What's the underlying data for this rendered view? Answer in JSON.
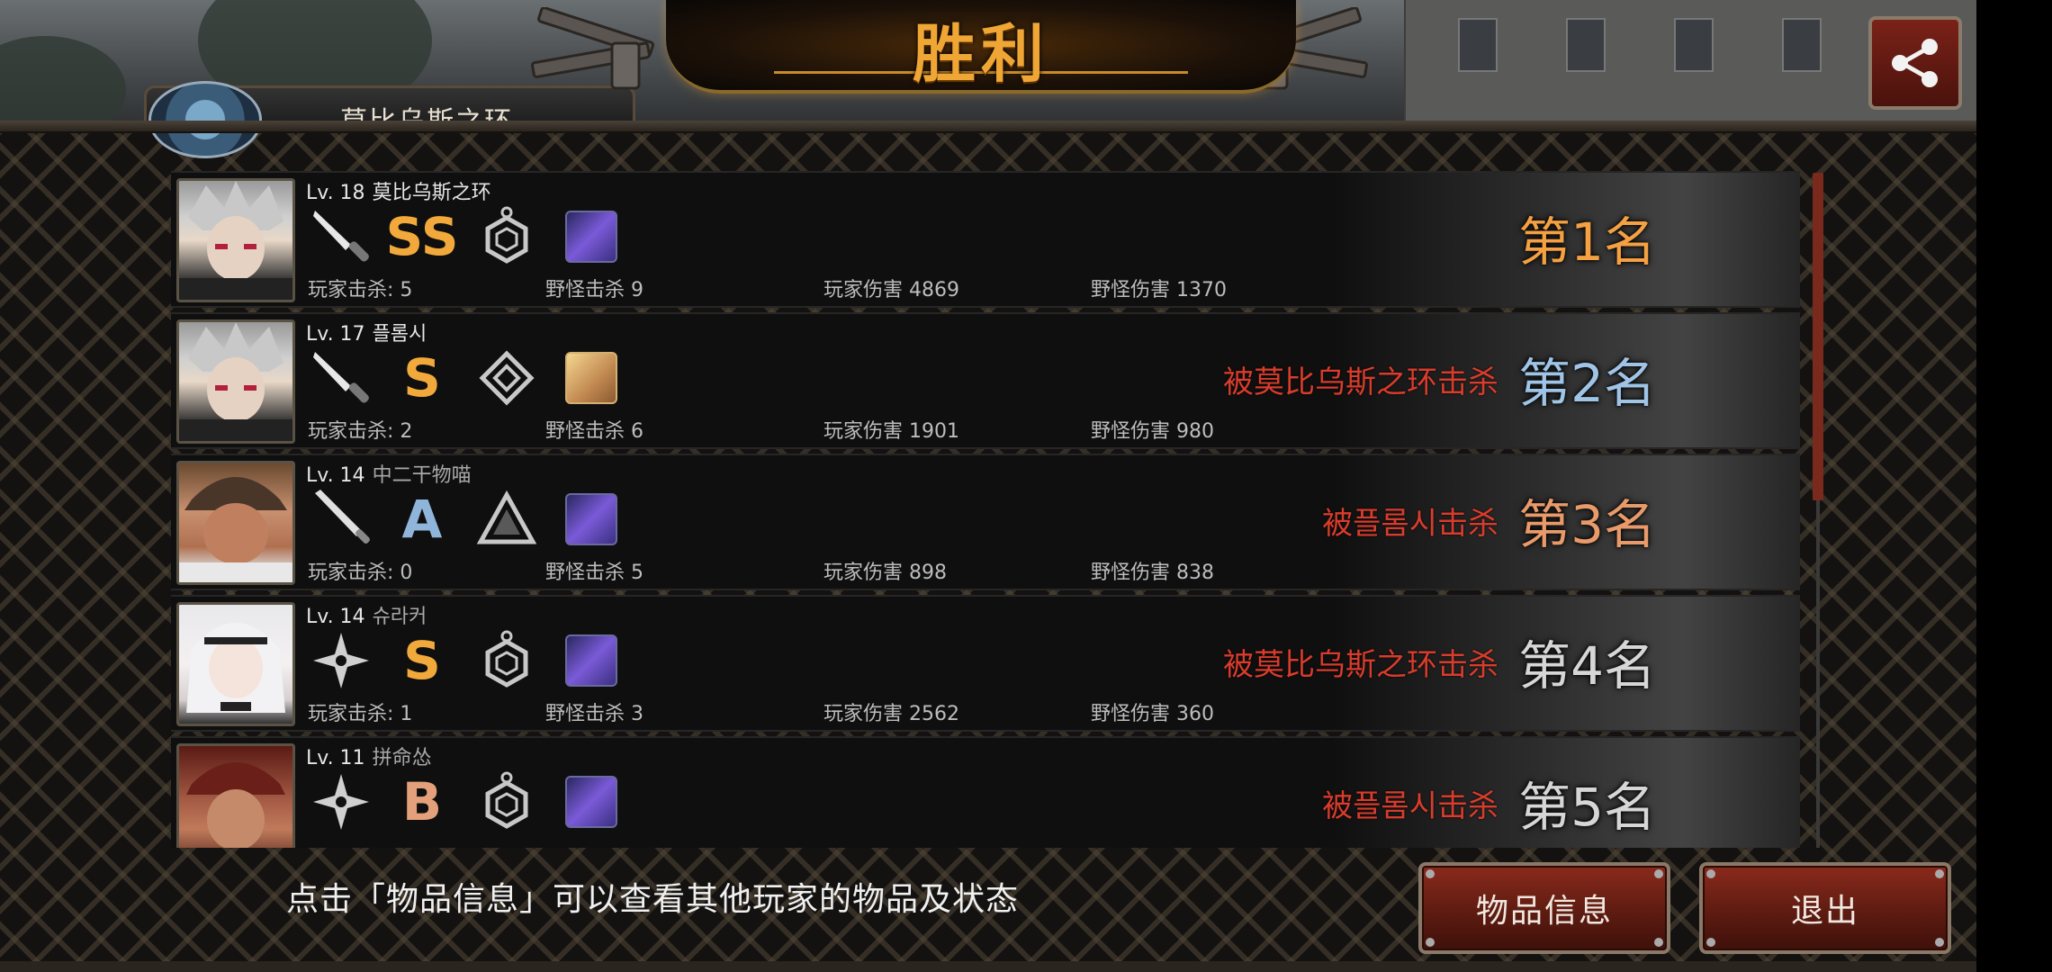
{
  "header": {
    "title": "胜利",
    "player_tab_name": "莫比乌斯之环"
  },
  "colors": {
    "title_gold": "#f0a635",
    "killed_by_red": "#d83c2c",
    "rank1": "#f4a043",
    "rank2": "#9fc4e6",
    "rank3": "#e89a6a",
    "rank_default": "#d6d6d6",
    "button_red": "#7a2218"
  },
  "icons": {
    "share": "share-icon",
    "weapon_knife": "knife-icon",
    "weapon_bat": "bat-icon",
    "weapon_shuriken": "shuriken-icon",
    "pet_purple": "purple-pet-icon",
    "pet_gold": "gold-pet-icon"
  },
  "players": [
    {
      "lv_label": "Lv. 18",
      "name": "莫比乌斯之环",
      "weapon": "knife",
      "grade": "SS",
      "killed_by": "",
      "rank": "第1名",
      "stats": {
        "player_kills": "玩家击杀: 5",
        "monster_kills": "野怪击杀 9",
        "player_damage": "玩家伤害 4869",
        "monster_damage": "野怪伤害 1370"
      }
    },
    {
      "lv_label": "Lv. 17",
      "name": "플롬시",
      "weapon": "knife",
      "grade": "S",
      "killed_by": "被莫比乌斯之环击杀",
      "rank": "第2名",
      "stats": {
        "player_kills": "玩家击杀: 2",
        "monster_kills": "野怪击杀 6",
        "player_damage": "玩家伤害 1901",
        "monster_damage": "野怪伤害 980"
      }
    },
    {
      "lv_label": "Lv. 14",
      "name": "中二干物喵",
      "weapon": "bat",
      "grade": "A",
      "killed_by": "被플롬시击杀",
      "rank": "第3名",
      "stats": {
        "player_kills": "玩家击杀: 0",
        "monster_kills": "野怪击杀 5",
        "player_damage": "玩家伤害 898",
        "monster_damage": "野怪伤害 838"
      }
    },
    {
      "lv_label": "Lv. 14",
      "name": "슈라커",
      "weapon": "shuriken",
      "grade": "S",
      "killed_by": "被莫比乌斯之环击杀",
      "rank": "第4名",
      "stats": {
        "player_kills": "玩家击杀: 1",
        "monster_kills": "野怪击杀 3",
        "player_damage": "玩家伤害 2562",
        "monster_damage": "野怪伤害 360"
      }
    },
    {
      "lv_label": "Lv. 11",
      "name": "拼命怂",
      "weapon": "shuriken",
      "grade": "B",
      "killed_by": "被플롬시击杀",
      "rank": "第5名"
    }
  ],
  "footer": {
    "hint": "点击「物品信息」可以查看其他玩家的物品及状态",
    "item_info_button": "物品信息",
    "exit_button": "退出"
  }
}
